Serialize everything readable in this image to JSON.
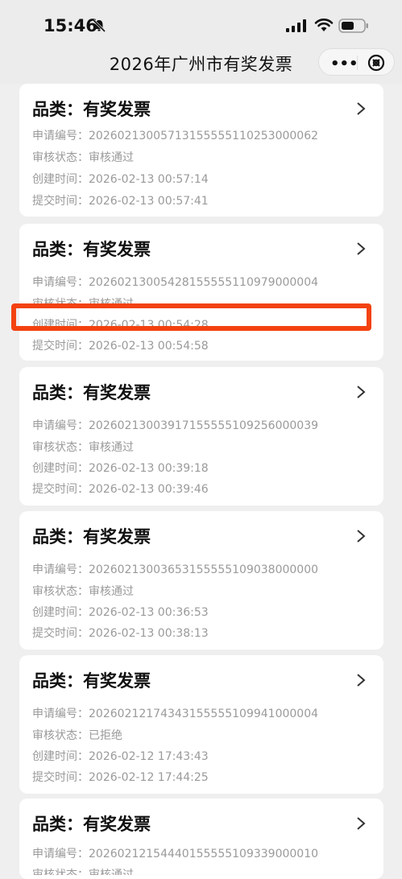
{
  "status_bar": {
    "time": "15:46"
  },
  "nav": {
    "title": "2026年广州市有奖发票",
    "more": "•••"
  },
  "labels": {
    "app_no": "申请编号：",
    "review": "审核状态：",
    "created": "创建时间：",
    "submitted": "提交时间："
  },
  "cards": [
    {
      "title": "品类：有奖发票",
      "app_no": "2026021300571315555511025300006 2",
      "review": "审核通过",
      "created": "2026-02-13 00:57:14",
      "submitted": "2026-02-13 00:57:41"
    },
    {
      "title": "品类：有奖发票",
      "app_no": "20260213005428155555110979000004",
      "review": "审核通过",
      "created": "2026-02-13 00:54:28",
      "submitted": "2026-02-13 00:54:58"
    },
    {
      "title": "品类：有奖发票",
      "app_no": "20260213003917155555109256000039",
      "review": "审核通过",
      "created": "2026-02-13 00:39:18",
      "submitted": "2026-02-13 00:39:46"
    },
    {
      "title": "品类：有奖发票",
      "app_no": "20260213003653155555109038000000",
      "review": "审核通过",
      "created": "2026-02-13 00:36:53",
      "submitted": "2026-02-13 00:38:13"
    },
    {
      "title": "品类：有奖发票",
      "app_no": "20260212174343155555109941000004",
      "review": "已拒绝",
      "created": "2026-02-12 17:43:43",
      "submitted": "2026-02-12 17:44:25"
    },
    {
      "title": "品类：有奖发票",
      "app_no": "20260212154440155555109339000010",
      "review": "审核通过",
      "created": "",
      "submitted": ""
    }
  ]
}
